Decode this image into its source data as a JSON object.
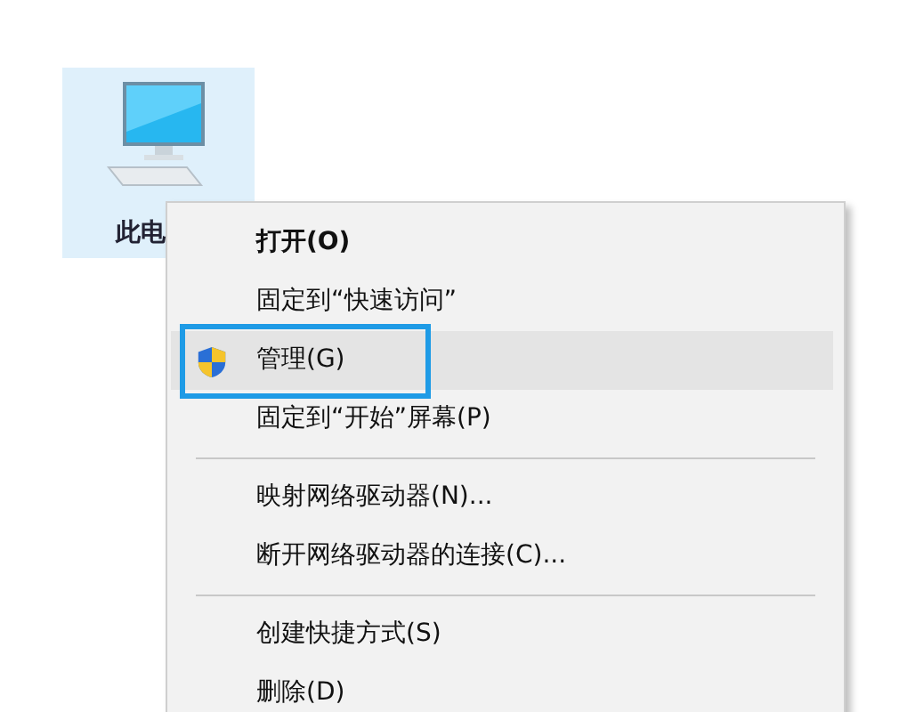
{
  "desktop_icon": {
    "label": "此电"
  },
  "context_menu": {
    "items": [
      {
        "kind": "command",
        "label": "打开(O)",
        "default": true,
        "selected": false,
        "outlined": false
      },
      {
        "kind": "command",
        "label": "固定到“快速访问”",
        "default": false,
        "selected": false,
        "outlined": false
      },
      {
        "kind": "admin-command",
        "label": "管理(G)",
        "default": false,
        "selected": true,
        "outlined": true
      },
      {
        "kind": "command",
        "label": "固定到“开始”屏幕(P)",
        "default": false,
        "selected": false,
        "outlined": false
      },
      {
        "kind": "separator"
      },
      {
        "kind": "command",
        "label": "映射网络驱动器(N)...",
        "default": false,
        "selected": false,
        "outlined": false
      },
      {
        "kind": "command",
        "label": "断开网络驱动器的连接(C)...",
        "default": false,
        "selected": false,
        "outlined": false
      },
      {
        "kind": "separator"
      },
      {
        "kind": "command",
        "label": "创建快捷方式(S)",
        "default": false,
        "selected": false,
        "outlined": false
      },
      {
        "kind": "command",
        "label": "删除(D)",
        "default": false,
        "selected": false,
        "outlined": false
      }
    ]
  }
}
